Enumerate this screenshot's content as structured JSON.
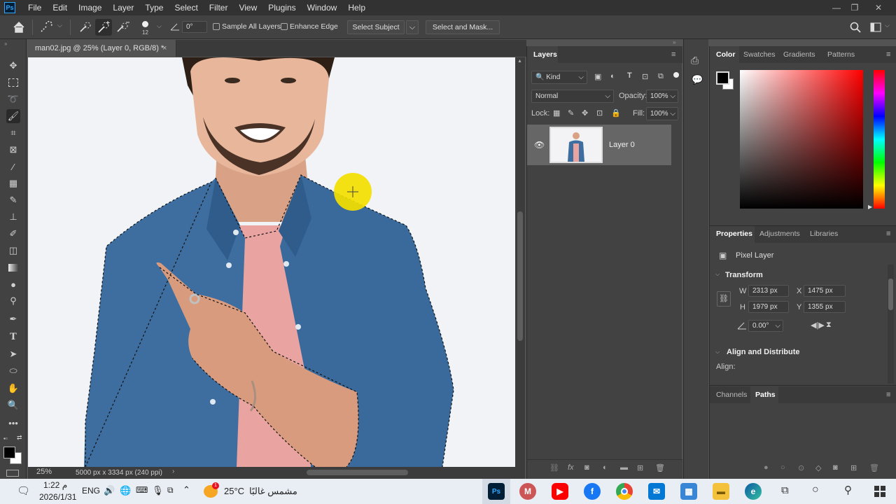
{
  "menubar": {
    "items": [
      "File",
      "Edit",
      "Image",
      "Layer",
      "Type",
      "Select",
      "Filter",
      "View",
      "Plugins",
      "Window",
      "Help"
    ],
    "logo": "Ps",
    "minimize": "—",
    "restore": "❐",
    "close": "✕"
  },
  "options": {
    "brush_size": "12",
    "angle": "0°",
    "sample_all_layers": "Sample All Layers",
    "enhance_edge": "Enhance Edge",
    "select_subject": "Select Subject",
    "select_and_mask": "Select and Mask..."
  },
  "document": {
    "tab_title": "man02.jpg @ 25% (Layer 0, RGB/8) *",
    "close": "×",
    "zoom": "25%",
    "info": "5000 px x 3334 px (240 ppi)"
  },
  "layers": {
    "tab": "Layers",
    "kind": "Kind",
    "blend_mode": "Normal",
    "opacity_label": "Opacity:",
    "opacity": "100%",
    "lock_label": "Lock:",
    "fill_label": "Fill:",
    "fill": "100%",
    "layer_name": "Layer 0"
  },
  "color_panel": {
    "tabs": [
      "Color",
      "Swatches",
      "Gradients",
      "Patterns"
    ],
    "foreground": "#000000",
    "background": "#ffffff",
    "hue_color": "#ff0000"
  },
  "properties": {
    "tabs": [
      "Properties",
      "Adjustments",
      "Libraries"
    ],
    "type": "Pixel Layer",
    "transform_label": "Transform",
    "w_label": "W",
    "w": "2313 px",
    "h_label": "H",
    "h": "1979 px",
    "x_label": "X",
    "x": "1475 px",
    "y_label": "Y",
    "y": "1355 px",
    "angle": "0.00°",
    "align_label": "Align and Distribute",
    "align": "Align:"
  },
  "channels": {
    "tabs": [
      "Channels",
      "Paths"
    ]
  },
  "taskbar": {
    "time": "1:22 م",
    "date": "2026/1/31",
    "lang": "ENG",
    "temp": "25°C",
    "weather": "مشمس غالبًا",
    "weather_badge": "1"
  }
}
